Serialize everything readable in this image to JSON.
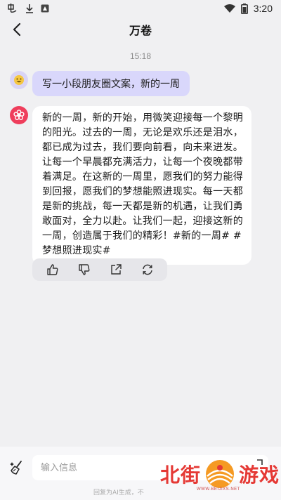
{
  "status_bar": {
    "time": "3:20"
  },
  "header": {
    "title": "万卷"
  },
  "chat": {
    "timestamp": "15:18",
    "user_message": "写一小段朋友圈文案，新的一周",
    "bot_message": "新的一周，新的开始，用微笑迎接每一个黎明的阳光。过去的一周，无论是欢乐还是泪水，都已成为过去，我们要向前看，向未来进发。让每一个早晨都充满活力，让每一个夜晚都带着满足。在这新的一周里，愿我们的努力能得到回报，愿我们的梦想能照进现实。每一天都是新的挑战，每一天都是新的机遇，让我们勇敢面对，全力以赴。让我们一起，迎接这新的一周，创造属于我们的精彩！#新的一周# #梦想照进现实#"
  },
  "actions": [
    "thumbs-up-icon",
    "thumbs-down-icon",
    "share-icon",
    "refresh-icon"
  ],
  "input": {
    "placeholder": "输入信息",
    "disclaimer": "回复为AI生成，不"
  },
  "watermark": {
    "left_text": "北街",
    "right_text": "游戏",
    "url": "WWW.BEIJIXS.NET"
  },
  "colors": {
    "background": "#f0f0f2",
    "user_bubble": "#d9d7fb",
    "bot_avatar": "#ef3e5c",
    "watermark": "#e53935"
  }
}
